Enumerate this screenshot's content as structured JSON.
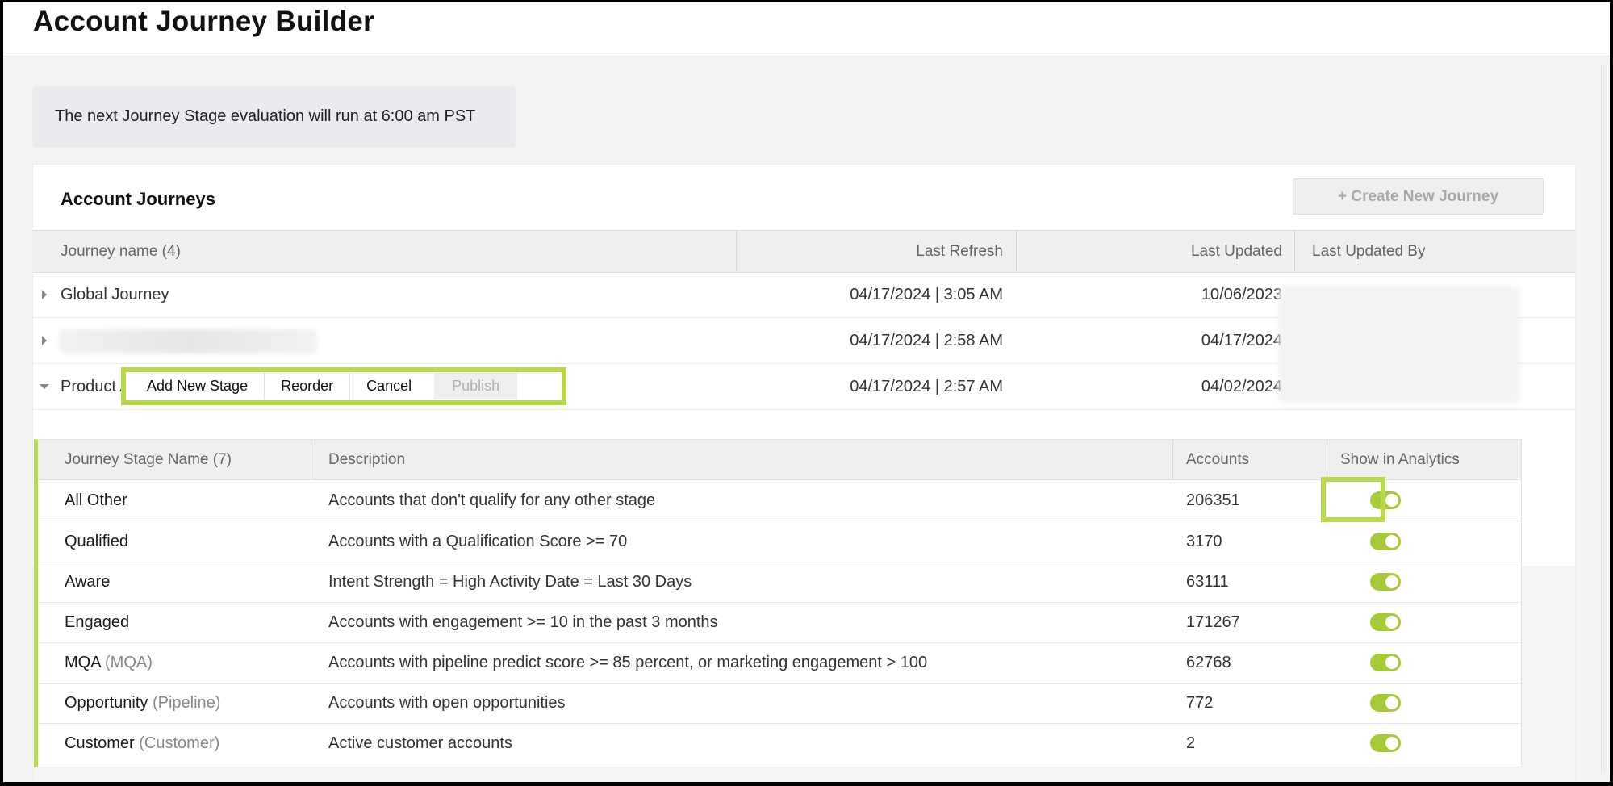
{
  "header": {
    "title": "Account Journey Builder"
  },
  "notice": {
    "text": "The next Journey Stage evaluation will run at 6:00 am PST"
  },
  "panel": {
    "title": "Account Journeys",
    "create_button": "+ Create New Journey"
  },
  "journeys_table": {
    "headers": {
      "name": "Journey name (4)",
      "last_refresh": "Last Refresh",
      "last_updated": "Last Updated",
      "last_updated_by": "Last Updated By"
    },
    "rows": [
      {
        "name": "Global Journey",
        "last_refresh": "04/17/2024 | 3:05 AM",
        "last_updated": "10/06/2023"
      },
      {
        "name": "",
        "last_refresh": "04/17/2024 | 2:58 AM",
        "last_updated": "04/17/2024"
      },
      {
        "name": "Product A",
        "last_refresh": "04/17/2024 | 2:57 AM",
        "last_updated": "04/02/2024"
      }
    ]
  },
  "actions": {
    "add_stage": "Add New Stage",
    "reorder": "Reorder",
    "cancel": "Cancel",
    "publish": "Publish"
  },
  "stages_table": {
    "headers": {
      "name": "Journey Stage Name (7)",
      "description": "Description",
      "accounts": "Accounts",
      "show": "Show in Analytics"
    },
    "rows": [
      {
        "name": "All Other",
        "suffix": "",
        "description": "Accounts that don't qualify for any other stage",
        "accounts": "206351",
        "show": true
      },
      {
        "name": "Qualified",
        "suffix": "",
        "description": "Accounts with a Qualification Score >= 70",
        "accounts": "3170",
        "show": true
      },
      {
        "name": "Aware",
        "suffix": "",
        "description": "Intent Strength = High Activity Date = Last 30 Days",
        "accounts": "63111",
        "show": true
      },
      {
        "name": "Engaged",
        "suffix": "",
        "description": "Accounts with engagement >= 10 in the past 3 months",
        "accounts": "171267",
        "show": true
      },
      {
        "name": "MQA",
        "suffix": "(MQA)",
        "description": "Accounts with pipeline predict score >= 85 percent, or marketing engagement > 100",
        "accounts": "62768",
        "show": true
      },
      {
        "name": "Opportunity",
        "suffix": "(Pipeline)",
        "description": "Accounts with open opportunities",
        "accounts": "772",
        "show": true
      },
      {
        "name": "Customer",
        "suffix": "(Customer)",
        "description": "Active customer accounts",
        "accounts": "2",
        "show": true
      }
    ]
  },
  "colors": {
    "accent": "#b9d94a",
    "toggle_on": "#a7cb38"
  }
}
